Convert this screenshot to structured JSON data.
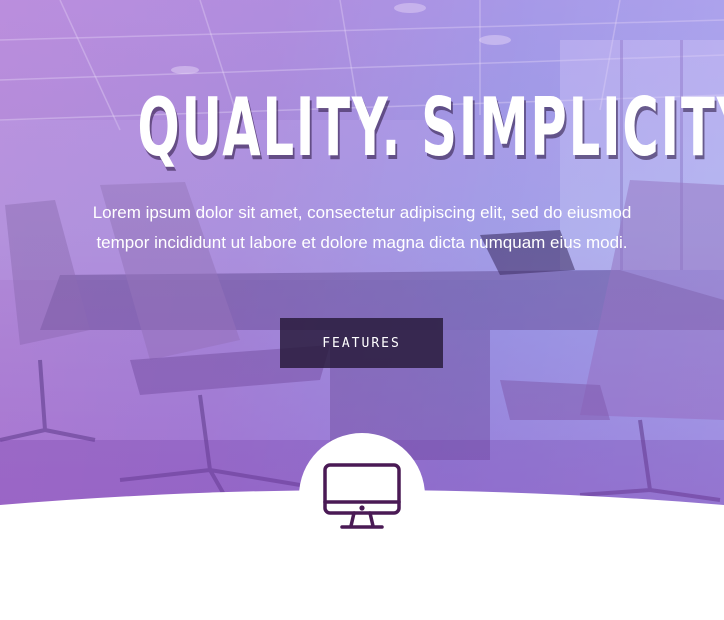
{
  "hero": {
    "title": "QUALITY. SIMPLICITY.",
    "subtitle": "Lorem ipsum dolor sit amet, consectetur adipiscing elit, sed do eiusmod tempor incididunt ut labore et dolore magna dicta numquam eius modi.",
    "button_label": "FEATURES",
    "background_image": "office-conference-room"
  },
  "feature_icon": "monitor-icon",
  "colors": {
    "overlay_start": "#b98fd6",
    "overlay_end": "#a7b4f0",
    "button_bg": "#261838",
    "icon_color": "#4a1a55"
  }
}
